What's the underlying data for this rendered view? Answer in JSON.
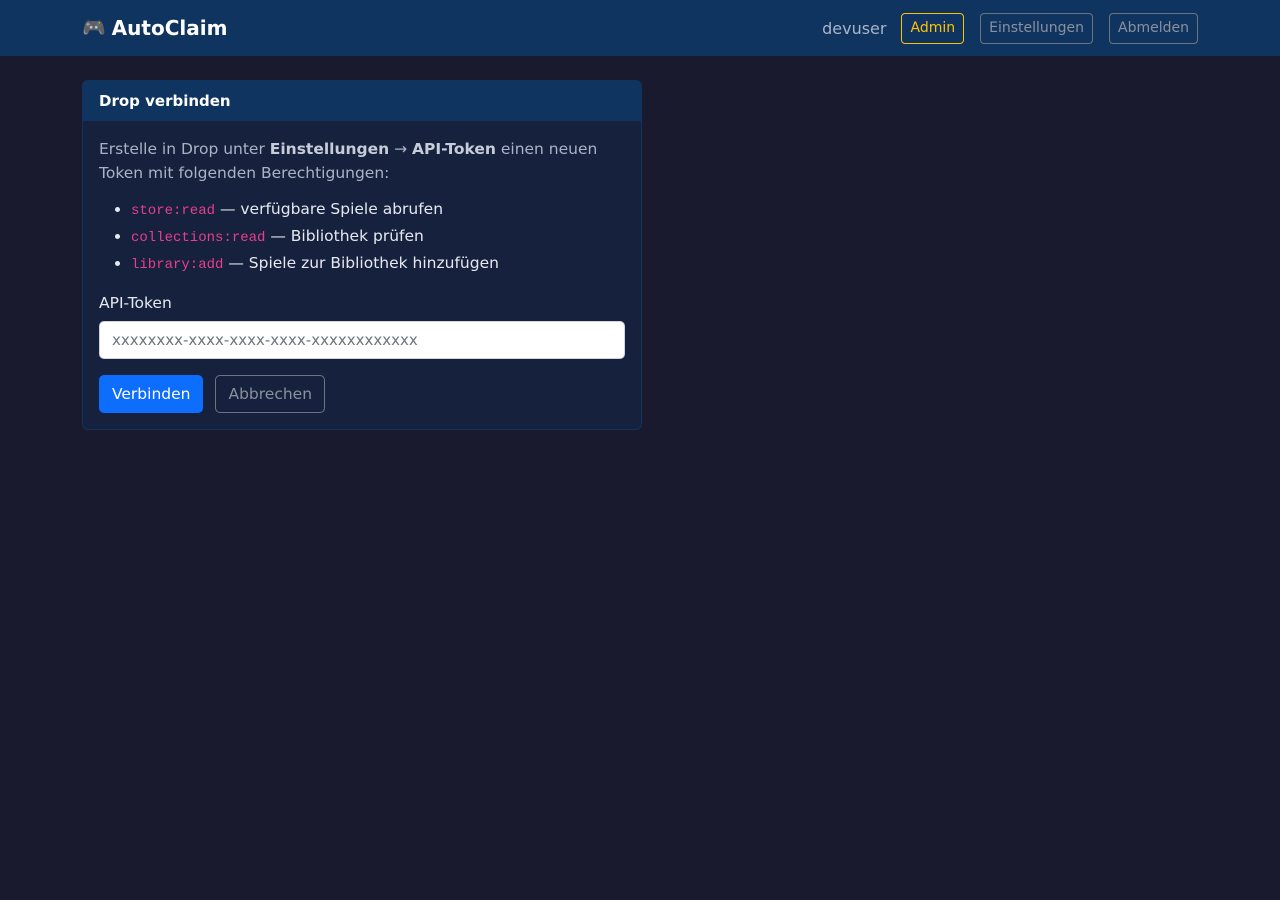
{
  "navbar": {
    "brand_icon": "🎮",
    "brand_icon_name": "gamepad-icon",
    "brand_label": "AutoClaim",
    "username": "devuser",
    "admin_label": "Admin",
    "settings_label": "Einstellungen",
    "logout_label": "Abmelden"
  },
  "card": {
    "title": "Drop verbinden",
    "intro_prefix": "Erstelle in Drop unter ",
    "intro_strong_1": "Einstellungen",
    "intro_arrow": " → ",
    "intro_strong_2": "API-Token",
    "intro_suffix": " einen neuen Token mit folgenden Berechtigungen:",
    "permissions": [
      {
        "scope": "store:read",
        "description": " — verfügbare Spiele abrufen"
      },
      {
        "scope": "collections:read",
        "description": " — Bibliothek prüfen"
      },
      {
        "scope": "library:add",
        "description": " — Spiele zur Bibliothek hinzufügen"
      }
    ],
    "token_label": "API-Token",
    "token_placeholder": "xxxxxxxx-xxxx-xxxx-xxxx-xxxxxxxxxxxx",
    "token_value": "",
    "connect_label": "Verbinden",
    "cancel_label": "Abbrechen"
  },
  "colors": {
    "page_background": "#1a1a2e",
    "navbar_background": "#0f3460",
    "card_background": "#16213e",
    "primary": "#0d6efd",
    "warning": "#ffc107",
    "code": "#e83e8c"
  }
}
